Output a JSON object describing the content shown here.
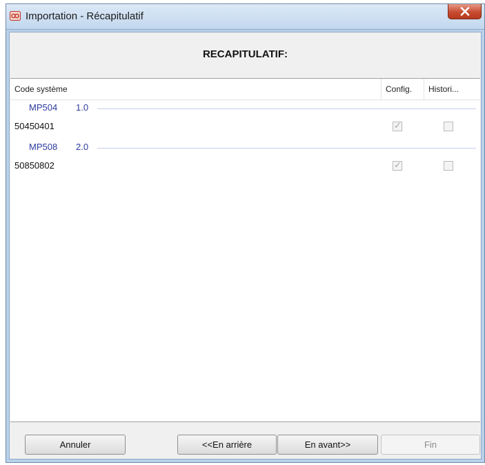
{
  "window": {
    "title": "Importation - Récapitulatif"
  },
  "heading": "RECAPITULATIF:",
  "columns": {
    "code": "Code système",
    "config": "Config.",
    "histo": "Histori..."
  },
  "groups": [
    {
      "name": "MP504",
      "version": "1.0",
      "rows": [
        {
          "code": "50450401",
          "config_checked": true,
          "histo_checked": false
        }
      ]
    },
    {
      "name": "MP508",
      "version": "2.0",
      "rows": [
        {
          "code": "50850802",
          "config_checked": true,
          "histo_checked": false
        }
      ]
    }
  ],
  "buttons": {
    "cancel": "Annuler",
    "back": "<<En arrière",
    "next": "En avant>>",
    "finish": "Fin"
  },
  "colors": {
    "group_text": "#2b3b9d",
    "close_button": "#c64b31"
  },
  "icons": {
    "app": "app-icon",
    "close": "close-icon",
    "check": "check-icon"
  }
}
